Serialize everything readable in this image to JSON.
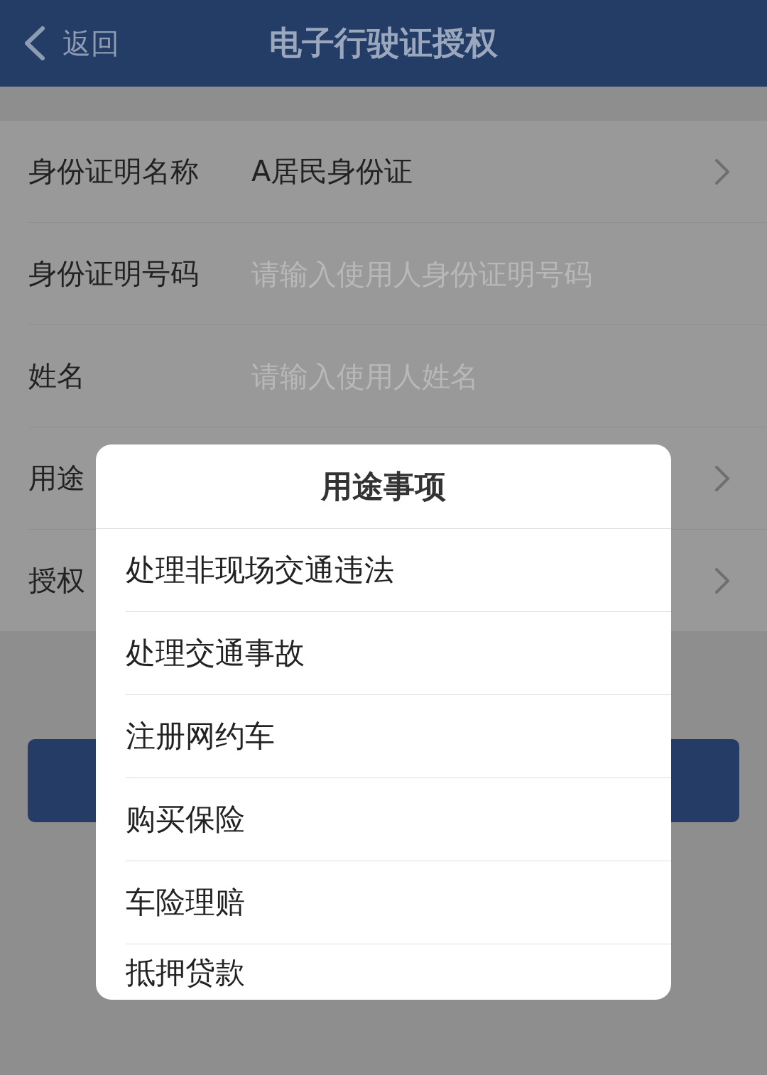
{
  "header": {
    "back_label": "返回",
    "title": "电子行驶证授权"
  },
  "form": {
    "rows": [
      {
        "kind": "select",
        "label": "身份证明名称",
        "value": "A居民身份证"
      },
      {
        "kind": "input",
        "label": "身份证明号码",
        "placeholder": "请输入使用人身份证明号码"
      },
      {
        "kind": "input",
        "label": "姓名",
        "placeholder": "请输入使用人姓名"
      },
      {
        "kind": "select",
        "label": "用途"
      },
      {
        "kind": "select",
        "label": "授权"
      }
    ]
  },
  "dialog": {
    "title": "用途事项",
    "options": [
      {
        "label": "处理非现场交通违法"
      },
      {
        "label": "处理交通事故"
      },
      {
        "label": "注册网约车"
      },
      {
        "label": "购买保险"
      },
      {
        "label": "车险理赔"
      },
      {
        "label": "抵押贷款"
      }
    ]
  }
}
